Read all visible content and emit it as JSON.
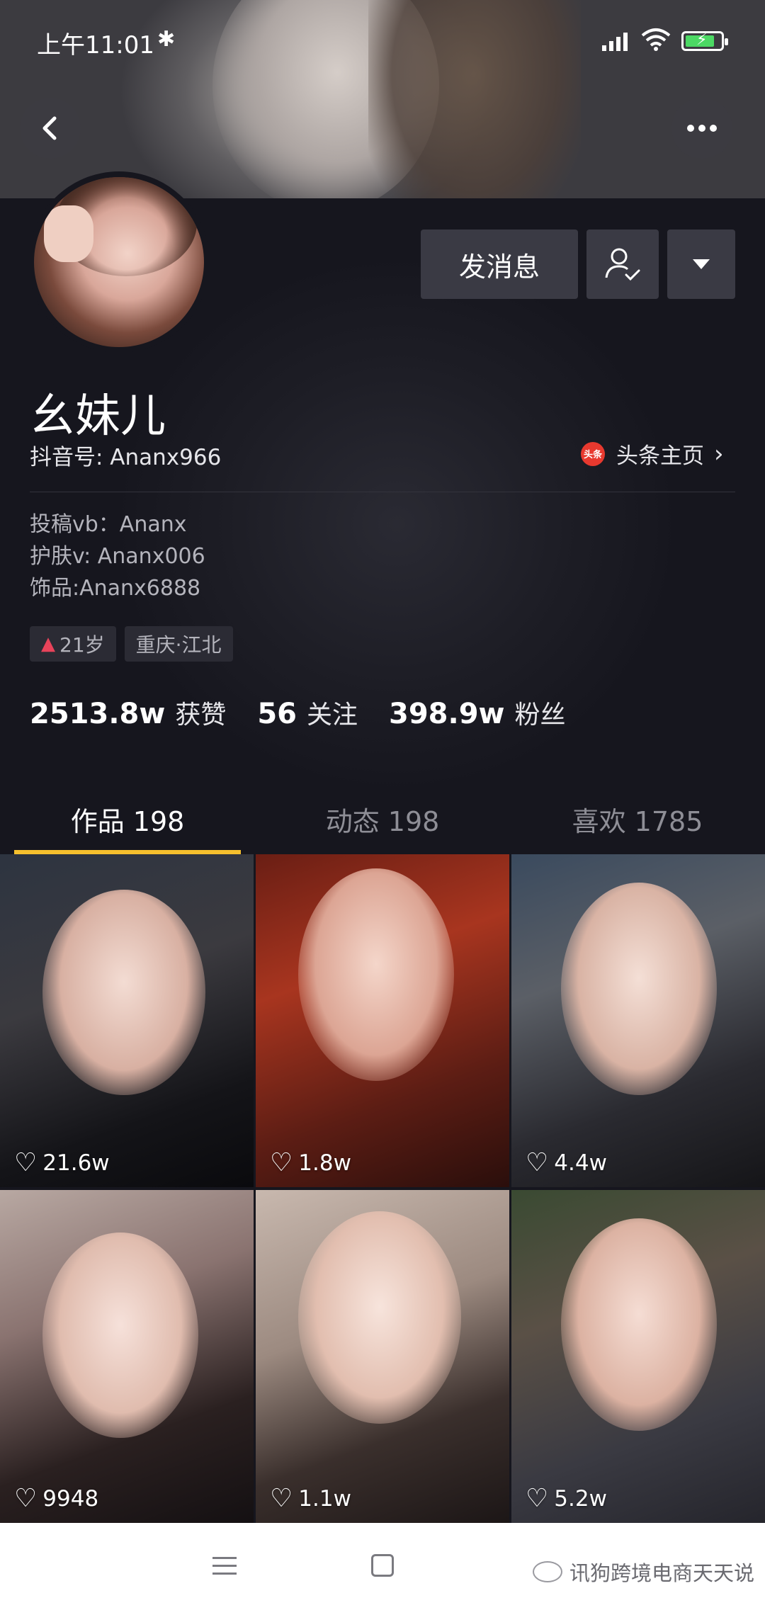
{
  "status_bar": {
    "time": "上午11:01",
    "bluetooth_icon": "bluetooth-icon",
    "signal_icon": "signal-icon",
    "wifi_icon": "wifi-icon",
    "battery_icon": "battery-charging-icon",
    "battery_color": "#4cd964"
  },
  "header": {
    "back_icon": "chevron-left-icon",
    "more_icon": "more-horizontal-icon"
  },
  "actions": {
    "message_label": "发消息",
    "follow_icon": "user-check-icon",
    "dropdown_icon": "triangle-down-icon"
  },
  "profile": {
    "name": "幺妹儿",
    "douyin_id": "抖音号: Ananx966",
    "toutiao_logo_text": "头条",
    "toutiao_label": "头条主页",
    "bio": [
      "投稿vb：Ananx",
      "护肤v: Ananx006",
      "饰品:Ananx6888"
    ],
    "tags": {
      "age": "21岁",
      "location": "重庆·江北"
    }
  },
  "stats": [
    {
      "value": "2513.8w",
      "label": "获赞"
    },
    {
      "value": "56",
      "label": "关注"
    },
    {
      "value": "398.9w",
      "label": "粉丝"
    }
  ],
  "tabs": [
    {
      "label": "作品 198",
      "active": true
    },
    {
      "label": "动态 198",
      "active": false
    },
    {
      "label": "喜欢 1785",
      "active": false
    }
  ],
  "videos": [
    {
      "likes": "21.6w"
    },
    {
      "likes": "1.8w"
    },
    {
      "likes": "4.4w"
    },
    {
      "likes": "9948"
    },
    {
      "likes": "1.1w"
    },
    {
      "likes": "5.2w"
    }
  ],
  "accent_color": "#f6c02e",
  "navbar": {
    "menu_icon": "menu-icon",
    "home_icon": "square-home-icon",
    "back_icon": "back-triangle-icon",
    "watermark": "讯狗跨境电商天天说"
  }
}
